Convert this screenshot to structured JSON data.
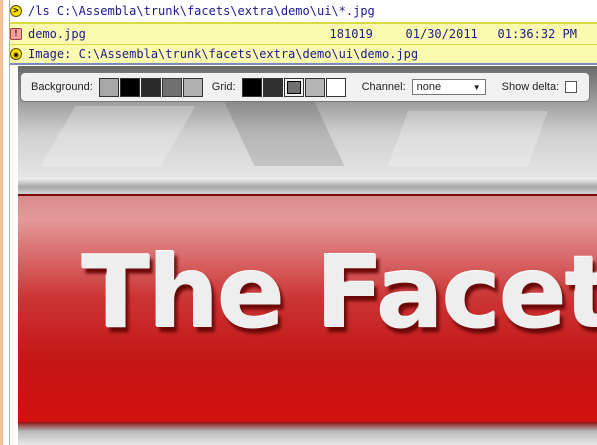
{
  "command_row": {
    "text": "/ls C:\\Assembla\\trunk\\facets\\extra\\demo\\ui\\*.jpg",
    "icon": "prompt-arrow-icon"
  },
  "file_row": {
    "name": "demo.jpg",
    "size": "181019",
    "date": "01/30/2011",
    "time": "01:36:32 PM",
    "icon": "file-icon"
  },
  "image_row": {
    "text": "Image: C:\\Assembla\\trunk\\facets\\extra\\demo\\ui\\demo.jpg",
    "icon": "eye-icon"
  },
  "toolbar": {
    "background_label": "Background:",
    "background_swatches": [
      "#a8a8a8",
      "#000000",
      "#2a2a2a",
      "#707070",
      "#b0b0b0"
    ],
    "grid_label": "Grid:",
    "grid_swatches": [
      "#000000",
      "#303030",
      "#707070",
      "#b4b4b4",
      "#ffffff"
    ],
    "channel_label": "Channel:",
    "channel_value": "none",
    "show_delta_label": "Show delta:",
    "show_delta_checked": false
  },
  "image": {
    "logo_text": "The Facets"
  }
}
